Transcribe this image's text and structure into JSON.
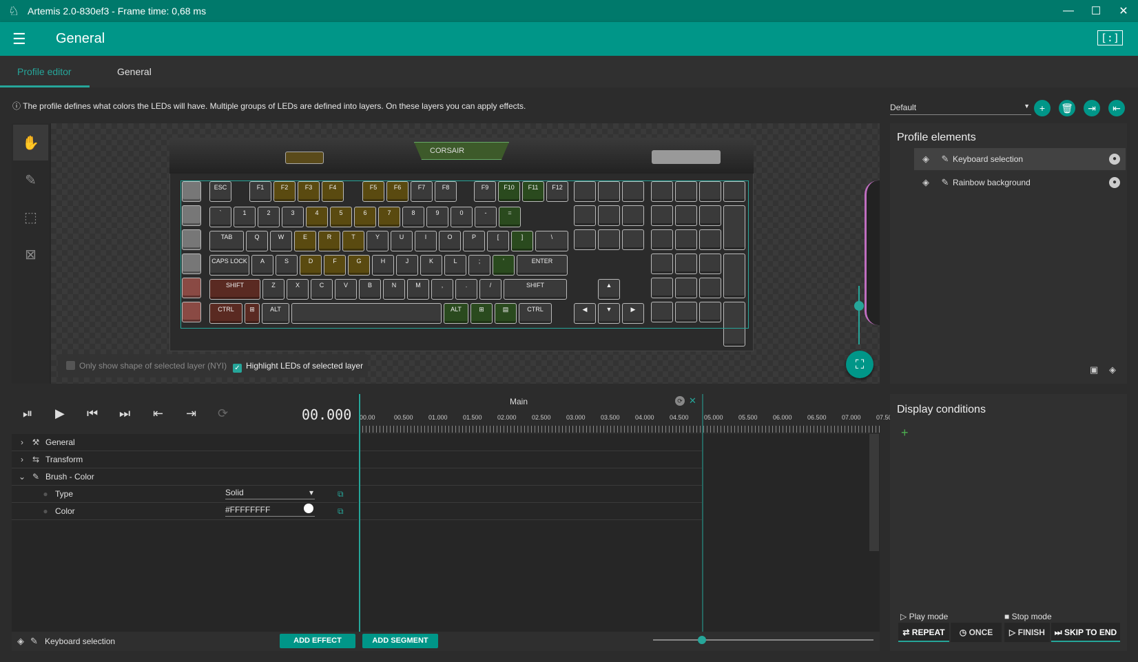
{
  "window": {
    "title": "Artemis 2.0-830ef3 - Frame time: 0,68 ms"
  },
  "appbar": {
    "title": "General"
  },
  "tabs": [
    {
      "label": "Profile editor"
    },
    {
      "label": "General"
    }
  ],
  "info": {
    "text": "The profile defines what colors the LEDs will have. Multiple groups of LEDs are defined into layers. On these layers you can apply effects."
  },
  "visualizer": {
    "option_shape": "Only show shape of selected layer (NYI)",
    "option_highlight": "Highlight LEDs of selected layer",
    "keyboard_brand": "CORSAIR"
  },
  "profile": {
    "selected": "Default"
  },
  "profile_elements": {
    "header": "Profile elements",
    "items": [
      {
        "label": "Keyboard selection",
        "selected": true
      },
      {
        "label": "Rainbow background",
        "selected": false
      }
    ]
  },
  "timeline": {
    "time": "00.000",
    "segment": "Main",
    "ticks": [
      "00.00",
      "00.500",
      "01.000",
      "01.500",
      "02.000",
      "02.500",
      "03.000",
      "03.500",
      "04.000",
      "04.500",
      "05.000",
      "05.500",
      "06.000",
      "06.500",
      "07.000",
      "07.50"
    ],
    "properties": [
      {
        "label": "General",
        "indent": 0,
        "arrow": "›"
      },
      {
        "label": "Transform",
        "indent": 0,
        "arrow": "›"
      },
      {
        "label": "Brush - Color",
        "indent": 0,
        "arrow": "⌄"
      },
      {
        "label": "Type",
        "indent": 1,
        "value": "Solid"
      },
      {
        "label": "Color",
        "indent": 1,
        "value": "#FFFFFFFF"
      }
    ],
    "footer_layer": "Keyboard selection",
    "add_effect": "ADD EFFECT",
    "add_segment": "ADD SEGMENT"
  },
  "display_conditions": {
    "header": "Display conditions",
    "play_mode": "Play mode",
    "stop_mode": "Stop mode",
    "repeat": "REPEAT",
    "once": "ONCE",
    "finish": "FINISH",
    "skip_to_end": "SKIP TO END"
  },
  "keys_row0": [
    "ESC",
    "F1",
    "F2",
    "F3",
    "F4",
    "F5",
    "F6",
    "F7",
    "F8",
    "F9",
    "F10",
    "F11",
    "F12"
  ],
  "keys_row1": [
    "`",
    "1",
    "2",
    "3",
    "4",
    "5",
    "6",
    "7",
    "8",
    "9",
    "0",
    "-",
    "="
  ],
  "keys_row2": [
    "TAB",
    "Q",
    "W",
    "E",
    "R",
    "T",
    "Y",
    "U",
    "I",
    "O",
    "P",
    "[",
    "]",
    "\\"
  ],
  "keys_row3": [
    "CAPS LOCK",
    "A",
    "S",
    "D",
    "F",
    "G",
    "H",
    "J",
    "K",
    "L",
    ";",
    "'",
    "ENTER"
  ],
  "keys_row4": [
    "SHIFT",
    "Z",
    "X",
    "C",
    "V",
    "B",
    "N",
    "M",
    ",",
    ".",
    "/",
    "SHIFT"
  ],
  "keys_row5": [
    "CTRL",
    "⊞",
    "ALT",
    "",
    "ALT",
    "⊞",
    "▤",
    "CTRL"
  ],
  "colors": {
    "accent": "#009688",
    "accent_dark": "#00796b",
    "accent_light": "#26a69a"
  }
}
